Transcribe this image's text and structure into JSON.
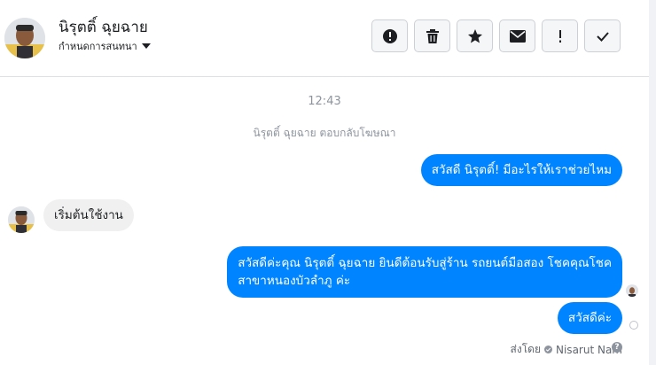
{
  "header": {
    "contact_name": "นิรุตติ์ ฉุยฉาย",
    "subtitle": "กำหนดการสนทนา",
    "toolbar": {
      "spam_icon": "alert-circle-icon",
      "delete_icon": "trash-icon",
      "star_icon": "star-icon",
      "unread_icon": "envelope-icon",
      "important_icon": "exclamation-icon",
      "done_icon": "checkmark-icon"
    }
  },
  "conversation": {
    "time": "12:43",
    "system_message": "นิรุตติ์ ฉุยฉาย ตอบกลับโฆษณา",
    "messages": [
      {
        "direction": "outgoing",
        "text": "สวัสดี นิรุตติ์! มีอะไรให้เราช่วยไหม"
      },
      {
        "direction": "incoming",
        "text": "เริ่มต้นใช้งาน"
      },
      {
        "direction": "outgoing",
        "lines": [
          "สวัสดีค่ะคุณ นิรุตติ์ ฉุยฉาย ยินดีต้อนรับสู่ร้าน รถยนต์มือสอง โชคคุณโชค",
          "สาขาหนองบัวลำภู ค่ะ"
        ]
      },
      {
        "direction": "outgoing",
        "text": "สวัสดีค่ะ"
      }
    ],
    "sent_by_label": "ส่งโดย",
    "sent_by_name": "Nisarut Nam"
  },
  "colors": {
    "accent": "#0084ff",
    "incoming_bubble": "#f0f0f0",
    "muted_text": "#8d949e"
  }
}
